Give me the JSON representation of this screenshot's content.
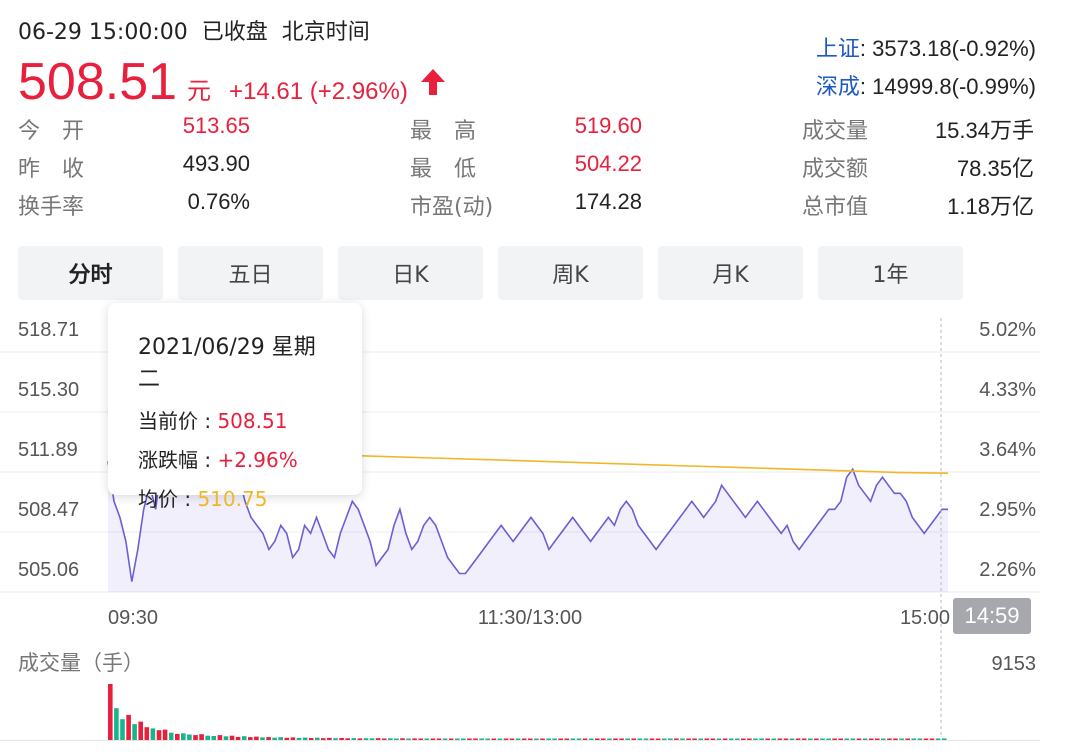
{
  "header": {
    "datetime": "06-29 15:00:00",
    "status": "已收盘",
    "timezone": "北京时间",
    "price": "508.51",
    "unit": "元",
    "change": "+14.61 (+2.96%)",
    "arrow_icon": "up-arrow-icon",
    "accent_color": "#e8203d"
  },
  "indices": [
    {
      "name": "上证",
      "value": ": 3573.18(-0.92%)"
    },
    {
      "name": "深成",
      "value": ": 14999.8(-0.99%)"
    }
  ],
  "stats": {
    "rows": [
      [
        {
          "label": "今　开",
          "value": "513.65",
          "red": true
        },
        {
          "label": "最　高",
          "value": "519.60",
          "red": true
        },
        {
          "label": "成交量",
          "value": "15.34万手",
          "red": false
        }
      ],
      [
        {
          "label": "昨　收",
          "value": "493.90",
          "red": false
        },
        {
          "label": "最　低",
          "value": "504.22",
          "red": true
        },
        {
          "label": "成交额",
          "value": "78.35亿",
          "red": false
        }
      ],
      [
        {
          "label": "换手率",
          "value": "0.76%",
          "red": false
        },
        {
          "label": "市盈(动)",
          "value": "174.28",
          "red": false
        },
        {
          "label": "总市值",
          "value": "1.18万亿",
          "red": false
        }
      ]
    ]
  },
  "tabs": [
    "分时",
    "五日",
    "日K",
    "周K",
    "月K",
    "1年"
  ],
  "active_tab": 0,
  "tooltip": {
    "date": "2021/06/29 星期二",
    "price_label": "当前价 : ",
    "price_value": "508.51",
    "change_label": "涨跌幅 : ",
    "change_value": "+2.96%",
    "avg_label": "均价 : ",
    "avg_value": "510.75"
  },
  "chart": {
    "y_left_ticks": [
      "518.71",
      "515.30",
      "511.89",
      "508.47",
      "505.06"
    ],
    "y_right_ticks": [
      "5.02%",
      "4.33%",
      "3.64%",
      "2.95%",
      "2.26%"
    ],
    "x_ticks": [
      "09:30",
      "11:30/13:00",
      "15:00"
    ],
    "cursor_time": "14:59",
    "volume_label": "成交量（手）",
    "volume_max": "9153",
    "price_line_color": "#6a5fd6",
    "avg_line_color": "#f0b729",
    "up_color": "#e8203d",
    "down_color": "#16b58b"
  },
  "chart_data": {
    "type": "line",
    "title": "",
    "ylim": [
      503.35,
      520.42
    ],
    "price_series": [
      511.5,
      509.0,
      508.0,
      506.5,
      504.0,
      506.0,
      508.5,
      510.0,
      508.5,
      511.5,
      512.5,
      513.5,
      514.5,
      515.0,
      513.5,
      511.5,
      512.5,
      513.0,
      514.0,
      513.0,
      512.0,
      511.0,
      510.5,
      509.0,
      508.0,
      507.5,
      507.0,
      506.0,
      506.5,
      507.5,
      507.0,
      505.5,
      506.0,
      507.5,
      507.0,
      508.0,
      507.0,
      506.0,
      505.5,
      507.0,
      508.0,
      509.0,
      508.5,
      507.5,
      506.5,
      505.0,
      505.5,
      506.0,
      507.5,
      508.5,
      507.0,
      506.0,
      506.5,
      507.5,
      508.0,
      507.5,
      506.5,
      505.5,
      505.0,
      504.5,
      504.5,
      505.0,
      505.5,
      506.0,
      506.5,
      507.0,
      507.5,
      507.0,
      506.5,
      507.0,
      507.5,
      508.0,
      507.5,
      507.0,
      506.0,
      506.5,
      507.0,
      507.5,
      508.0,
      507.5,
      507.0,
      506.5,
      507.0,
      507.5,
      508.0,
      507.5,
      508.5,
      509.0,
      508.5,
      507.5,
      507.0,
      506.5,
      506.0,
      506.5,
      507.0,
      507.5,
      508.0,
      508.5,
      509.0,
      508.5,
      508.0,
      508.5,
      509.0,
      510.0,
      509.5,
      509.0,
      508.5,
      508.0,
      508.5,
      509.0,
      508.5,
      508.0,
      507.5,
      507.0,
      507.5,
      506.5,
      506.0,
      506.5,
      507.0,
      507.5,
      508.0,
      508.5,
      508.5,
      509.0,
      510.5,
      511.0,
      510.0,
      509.5,
      509.0,
      510.0,
      510.5,
      510.0,
      509.5,
      509.5,
      509.0,
      508.0,
      507.5,
      507.0,
      507.5,
      508.0,
      508.5,
      508.5
    ],
    "avg_series": [
      511.9,
      511.8,
      511.7,
      511.6,
      511.5,
      511.4,
      511.3,
      511.2,
      511.1,
      511.0,
      510.9,
      510.8,
      510.75
    ],
    "volume_bars": [
      9153,
      5200,
      3400,
      4100,
      2600,
      3000,
      2100,
      1900,
      1600,
      1700,
      1200,
      1000,
      1100,
      900,
      800,
      950,
      700,
      650,
      800,
      600,
      700,
      500,
      620,
      480,
      550,
      420,
      480,
      380,
      450,
      360,
      420,
      350,
      400,
      320,
      380,
      300,
      340,
      290,
      330,
      280,
      310,
      260,
      300,
      270,
      290,
      250,
      280,
      240,
      270,
      230,
      260,
      220,
      250,
      210,
      240,
      220,
      230,
      200,
      220,
      210,
      200,
      190,
      210,
      180,
      200,
      190,
      180,
      170,
      190,
      160,
      180,
      170,
      160,
      170,
      150,
      160,
      150,
      150,
      140,
      160,
      140,
      150,
      130,
      140,
      150,
      130,
      140,
      120,
      130,
      120,
      140,
      110,
      130,
      120,
      110,
      120,
      110,
      130,
      100,
      120,
      110,
      100,
      110,
      100,
      120,
      100,
      110,
      100,
      90,
      110,
      100,
      90,
      100,
      95,
      90,
      100,
      90,
      95,
      85,
      90,
      95,
      85,
      90,
      80,
      95,
      85,
      90,
      80,
      85,
      90,
      80,
      85,
      80,
      90,
      80,
      85,
      200,
      260
    ]
  }
}
